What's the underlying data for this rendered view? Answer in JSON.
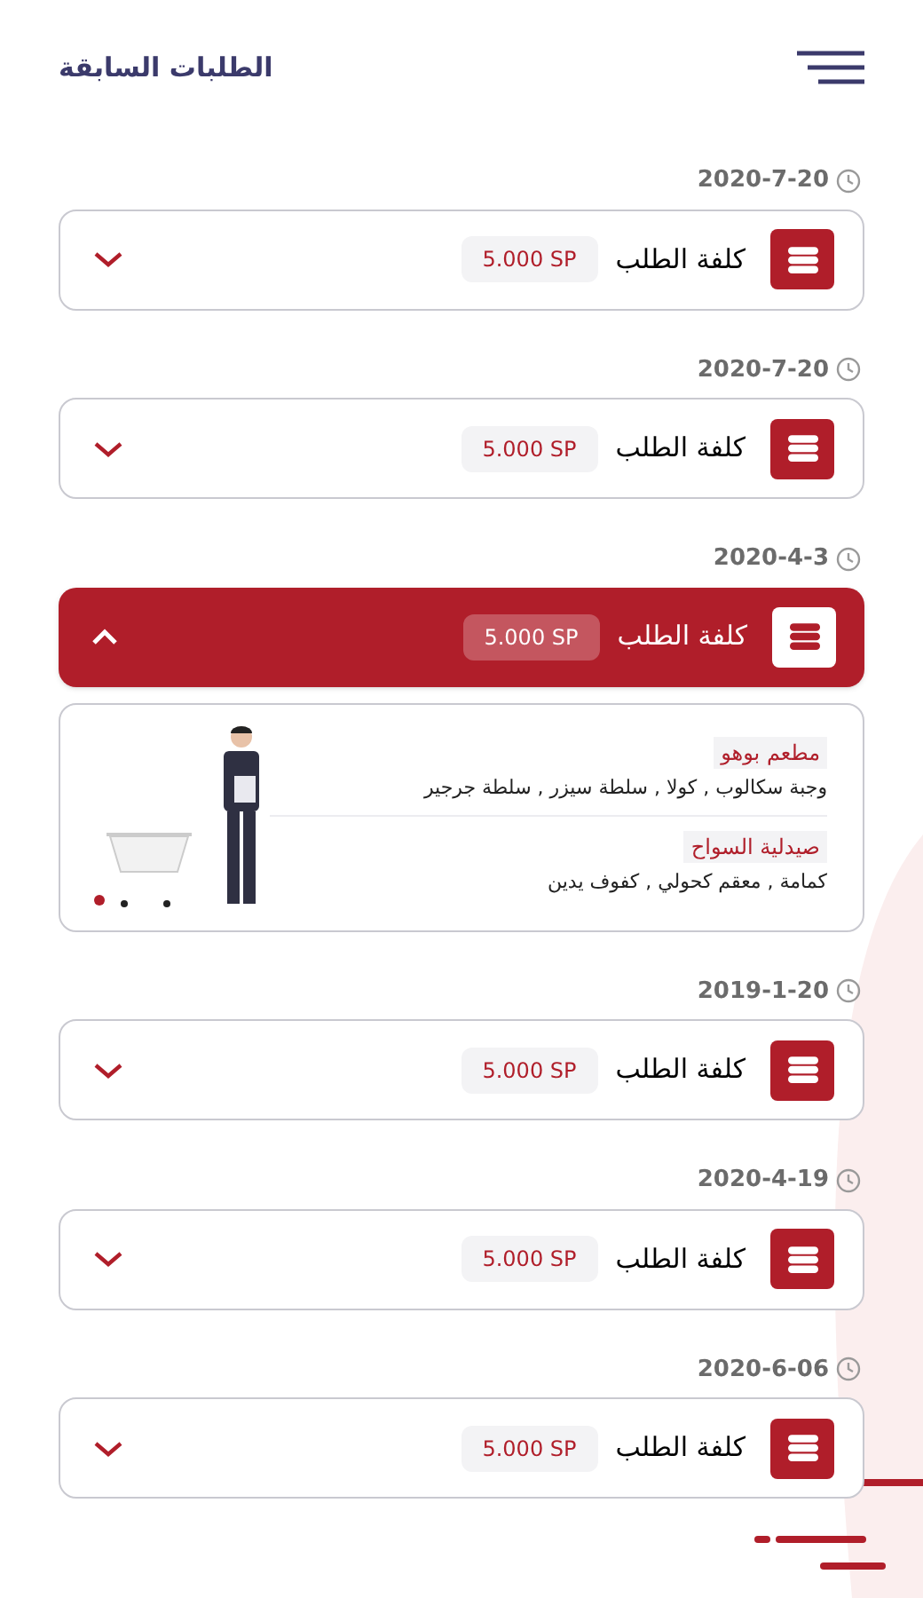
{
  "header": {
    "title": "الطلبات السابقة"
  },
  "orders": [
    {
      "date": "2020-7-20",
      "label": "كلفة الطلب",
      "amount": "5.000 SP",
      "expanded": false
    },
    {
      "date": "2020-7-20",
      "label": "كلفة الطلب",
      "amount": "5.000 SP",
      "expanded": false
    },
    {
      "date": "2020-4-3",
      "label": "كلفة الطلب",
      "amount": "5.000 SP",
      "expanded": true,
      "details": [
        {
          "store": "مطعم بوهو",
          "items": "وجبة سكالوب , كولا , سلطة سيزر , سلطة جرجير"
        },
        {
          "store": "صيدلية السواح",
          "items": "كمامة , معقم كحولي , كفوف يدين"
        }
      ]
    },
    {
      "date": "2019-1-20",
      "label": "كلفة الطلب",
      "amount": "5.000 SP",
      "expanded": false
    },
    {
      "date": "2020-4-19",
      "label": "كلفة الطلب",
      "amount": "5.000 SP",
      "expanded": false
    },
    {
      "date": "2020-6-06",
      "label": "كلفة الطلب",
      "amount": "5.000 SP",
      "expanded": false
    }
  ]
}
